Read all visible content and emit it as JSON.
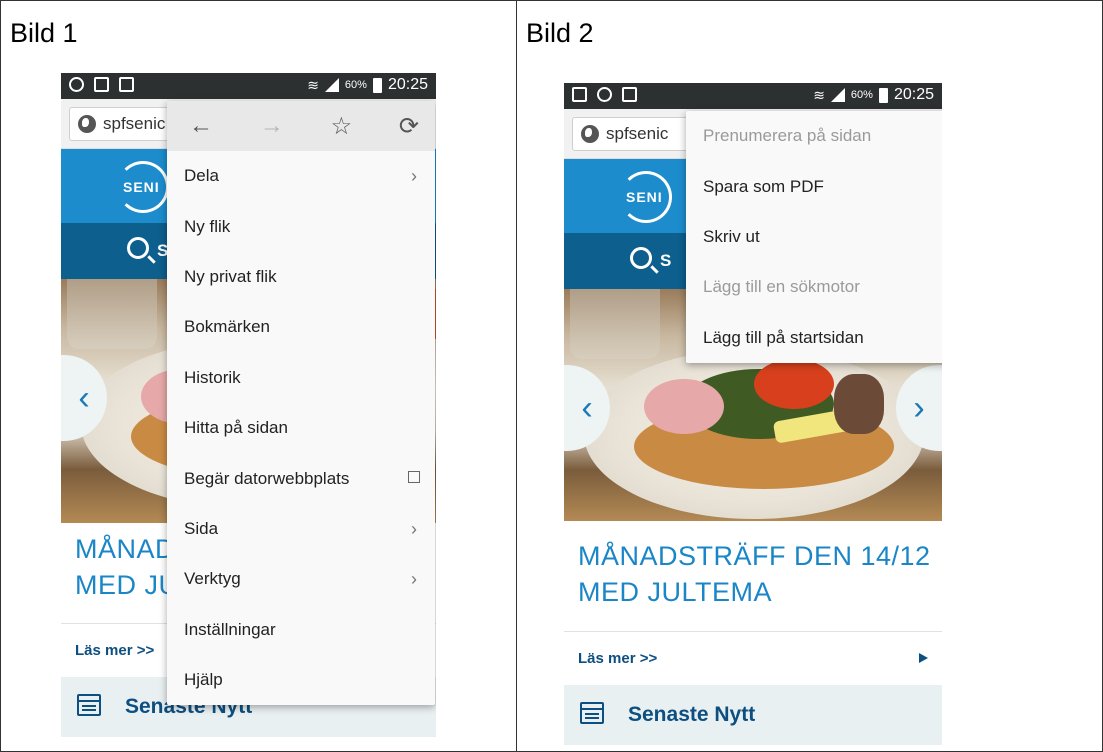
{
  "panels": [
    {
      "label": "Bild 1",
      "status": {
        "battery": "60%",
        "time": "20:25"
      },
      "url": "spfsenic",
      "site": {
        "logo": "SENI",
        "search_letter": "S",
        "headline_lines": [
          "MÅNAD",
          "MED JU"
        ],
        "read_more": "Läs mer >>",
        "news_title": "Senaste Nytt"
      },
      "menu": {
        "toolbar": [
          "back-icon",
          "forward-icon",
          "star-icon",
          "reload-icon"
        ],
        "items": [
          "Dela",
          "Ny flik",
          "Ny privat flik",
          "Bokmärken",
          "Historik",
          "Hitta på sidan",
          "Begär datorwebbplats",
          "Sida",
          "Verktyg",
          "Inställningar",
          "Hjälp"
        ]
      }
    },
    {
      "label": "Bild 2",
      "status": {
        "battery": "60%",
        "time": "20:25"
      },
      "url": "spfsenic",
      "site": {
        "logo": "SENI",
        "search_letter": "S",
        "headline_lines": [
          "MÅNADSTRÄFF DEN 14/12",
          "MED JULTEMA"
        ],
        "read_more": "Läs mer >>",
        "news_title": "Senaste Nytt"
      },
      "menu": {
        "items": [
          "Prenumerera på sidan",
          "Spara som PDF",
          "Skriv ut",
          "Lägg till en sökmotor",
          "Lägg till på startsidan"
        ],
        "disabled": [
          "Prenumerera på sidan",
          "Lägg till en sökmotor"
        ]
      }
    }
  ]
}
